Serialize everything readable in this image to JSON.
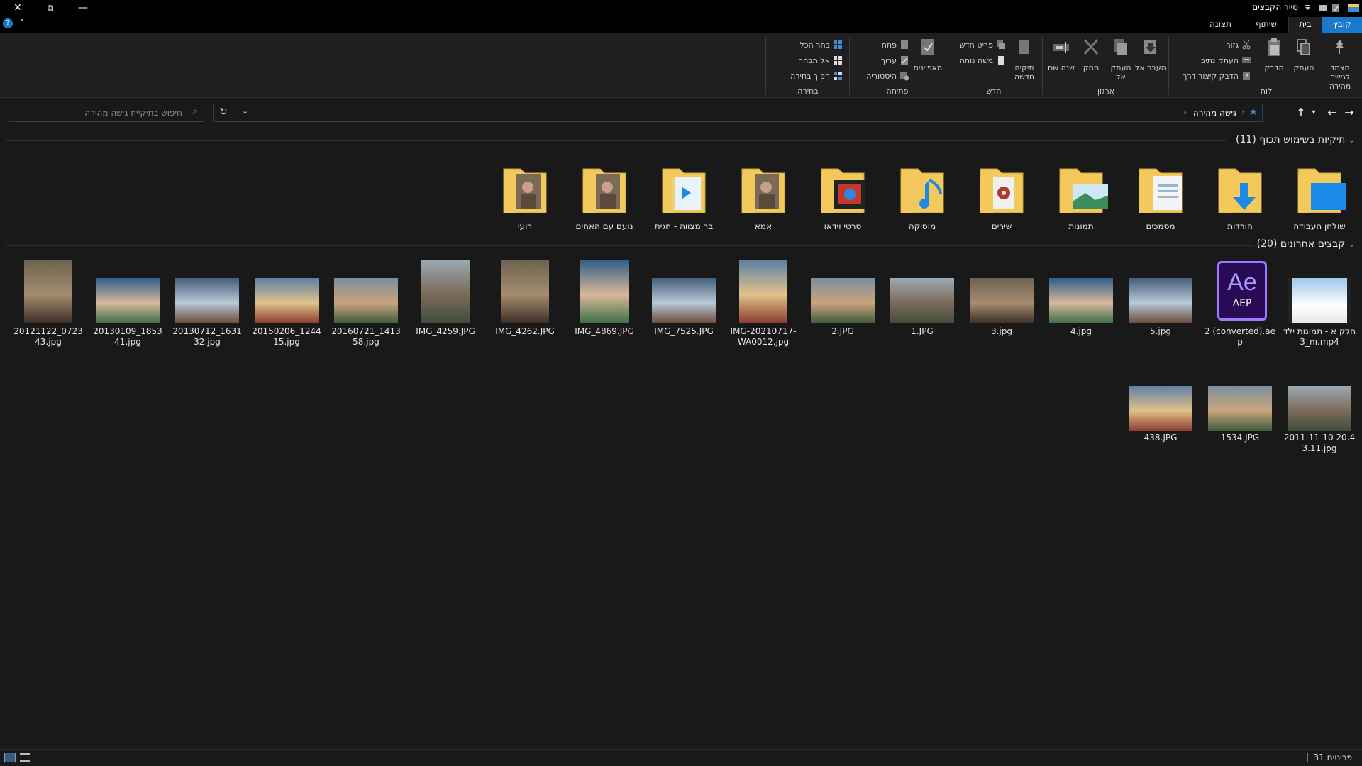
{
  "window": {
    "title": "סייר הקבצים",
    "close_glyph": "✕",
    "restore_glyph": "⧉",
    "minimize_glyph": "—",
    "help_glyph": "?",
    "collapse_ribbon_glyph": "⌃"
  },
  "tabs": [
    {
      "label": "קובץ"
    },
    {
      "label": "בית"
    },
    {
      "label": "שיתוף"
    },
    {
      "label": "תצוגה"
    }
  ],
  "ribbon": {
    "groups": {
      "clipboard": "לוח",
      "organize": "ארגון",
      "new": "חדש",
      "open": "פתיחה",
      "select": "בחירה"
    },
    "pin_quick_access": "הצמד לגישה מהירה",
    "copy": "העתק",
    "paste": "הדבק",
    "cut": "גזור",
    "copy_path": "העתק נתיב",
    "paste_shortcut": "הדבק קיצור דרך",
    "move_to": "העבר אל",
    "copy_to": "העתק אל",
    "delete": "מחק",
    "rename": "שנה שם",
    "new_folder": "תיקיה חדשה",
    "new_item": "פריט חדש",
    "easy_access": "גישה נוחה",
    "properties": "מאפיינים",
    "open": "פתח",
    "edit": "ערוך",
    "history": "היסטוריה",
    "select_all": "בחר הכל",
    "select_none": "אל תבחר",
    "invert_selection": "הפוך בחירה"
  },
  "address": {
    "path": "גישה מהירה",
    "search_placeholder": "חיפוש בתיקיית גישה מהירה"
  },
  "sections": {
    "frequent": "תיקיות בשימוש תכוף (11)",
    "recent": "קבצים אחרונים (20)"
  },
  "frequent_folders": [
    {
      "label": "שולחן העבודה",
      "icon": "desktop-folder-icon"
    },
    {
      "label": "הורדות",
      "icon": "downloads-folder-icon"
    },
    {
      "label": "מסמכים",
      "icon": "documents-folder-icon"
    },
    {
      "label": "תמונות",
      "icon": "pictures-folder-icon"
    },
    {
      "label": "שירים",
      "icon": "songs-folder-icon"
    },
    {
      "label": "מוסיקה",
      "icon": "music-folder-icon"
    },
    {
      "label": "סרטי וידאו",
      "icon": "videos-folder-icon"
    },
    {
      "label": "אמא",
      "icon": "photo-folder-icon"
    },
    {
      "label": "בר מצווה - חגית",
      "icon": "video-folder-icon"
    },
    {
      "label": "נועם עם האחים",
      "icon": "photo-folder-icon"
    },
    {
      "label": "רועי",
      "icon": "photo-folder-icon"
    }
  ],
  "recent_files": [
    {
      "label": "חלק א - תמונות ילדות_3.mp4",
      "kind": "video"
    },
    {
      "label": "2 (converted).aep",
      "kind": "aep"
    },
    {
      "label": "5.jpg",
      "kind": "photo"
    },
    {
      "label": "4.jpg",
      "kind": "photo"
    },
    {
      "label": "3.jpg",
      "kind": "photo"
    },
    {
      "label": "1.JPG",
      "kind": "photo"
    },
    {
      "label": "2.JPG",
      "kind": "photo"
    },
    {
      "label": "IMG-20210717-WA0012.jpg",
      "kind": "photo-tall"
    },
    {
      "label": "IMG_7525.JPG",
      "kind": "photo"
    },
    {
      "label": "IMG_4869.JPG",
      "kind": "photo-tall"
    },
    {
      "label": "IMG_4262.JPG",
      "kind": "photo-tall"
    },
    {
      "label": "IMG_4259.JPG",
      "kind": "photo-tall"
    },
    {
      "label": "20160721_141358.jpg",
      "kind": "photo"
    },
    {
      "label": "20150206_124415.jpg",
      "kind": "photo"
    },
    {
      "label": "20130712_163132.jpg",
      "kind": "photo"
    },
    {
      "label": "20130109_185341.jpg",
      "kind": "photo"
    },
    {
      "label": "20121122_072343.jpg",
      "kind": "photo-tall"
    },
    {
      "label": "2011-11-10 20.43.11.jpg",
      "kind": "photo"
    },
    {
      "label": "1534.JPG",
      "kind": "photo"
    },
    {
      "label": "438.JPG",
      "kind": "photo"
    }
  ],
  "aep_text": {
    "logo": "Ae",
    "sub": "AEP"
  },
  "status": {
    "item_count": "31 פריטים"
  },
  "colors": {
    "accent": "#1979ca",
    "folder": "#f3c95c",
    "aep": "#2a0a55",
    "aep_text": "#a99cff"
  }
}
